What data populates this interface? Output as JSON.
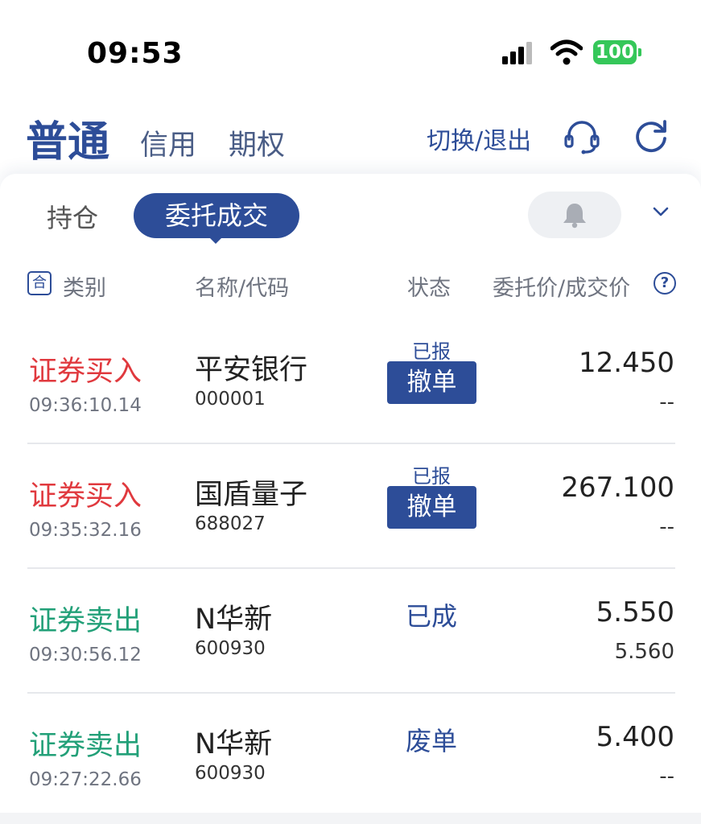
{
  "status_bar": {
    "time": "09:53",
    "battery": "100"
  },
  "top_nav": {
    "tab_normal": "普通",
    "tab_credit": "信用",
    "tab_options": "期权",
    "switch_exit": "切换/退出"
  },
  "sub_tabs": {
    "holdings": "持仓",
    "orders": "委托成交"
  },
  "table_header": {
    "merge_icon": "合",
    "type": "类别",
    "name_code": "名称/代码",
    "status": "状态",
    "price": "委托价/成交价",
    "help_icon": "?"
  },
  "orders": [
    {
      "type": "证券买入",
      "side": "buy",
      "time": "09:36:10.14",
      "name": "平安银行",
      "code": "000001",
      "status": "已报",
      "cancel_label": "撤单",
      "order_price": "12.450",
      "deal_price": "--"
    },
    {
      "type": "证券买入",
      "side": "buy",
      "time": "09:35:32.16",
      "name": "国盾量子",
      "code": "688027",
      "status": "已报",
      "cancel_label": "撤单",
      "order_price": "267.100",
      "deal_price": "--"
    },
    {
      "type": "证券卖出",
      "side": "sell",
      "time": "09:30:56.12",
      "name": "N华新",
      "code": "600930",
      "status": "已成",
      "order_price": "5.550",
      "deal_price": "5.560"
    },
    {
      "type": "证券卖出",
      "side": "sell",
      "time": "09:27:22.66",
      "name": "N华新",
      "code": "600930",
      "status": "废单",
      "order_price": "5.400",
      "deal_price": "--"
    }
  ],
  "colors": {
    "accent": "#2d4d98",
    "buy": "#e0393e",
    "sell": "#22a078",
    "battery": "#35c759"
  },
  "icons": [
    "signal-icon",
    "wifi-icon",
    "headset-icon",
    "refresh-icon",
    "bell-icon",
    "chevron-down-icon"
  ]
}
